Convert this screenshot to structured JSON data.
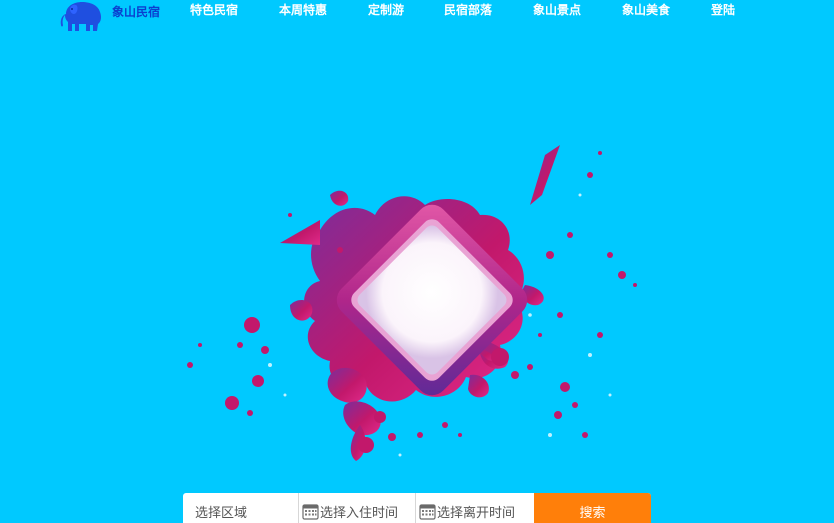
{
  "brand": {
    "name": "象山民宿",
    "logo_icon": "elephant-icon",
    "logo_color": "#1f4fe0"
  },
  "nav": {
    "items": [
      {
        "label": "特色民宿"
      },
      {
        "label": "本周特惠"
      },
      {
        "label": "定制游"
      },
      {
        "label": "民宿部落"
      },
      {
        "label": "象山景点"
      },
      {
        "label": "象山美食"
      },
      {
        "label": "登陆"
      }
    ]
  },
  "hero": {
    "icon": "paint-splash-frame-icon",
    "colors": [
      "#c2186b",
      "#7b2c9e",
      "#e02a8a"
    ]
  },
  "search": {
    "region_placeholder": "选择区域",
    "checkin_placeholder": "选择入住时间",
    "checkout_placeholder": "选择离开时间",
    "calendar_icon": "calendar-icon",
    "button_label": "搜索",
    "button_color": "#ff7f0a"
  },
  "theme": {
    "background": "#00c9ff",
    "nav_text": "#ffffff"
  }
}
